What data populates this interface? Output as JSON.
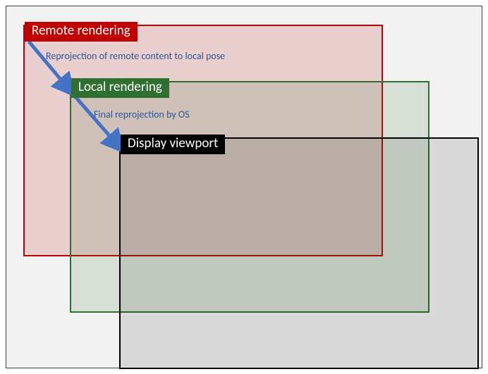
{
  "boxes": {
    "remote": {
      "label": "Remote rendering"
    },
    "local": {
      "label": "Local rendering"
    },
    "display": {
      "label": "Display viewport"
    }
  },
  "captions": {
    "reproj_remote": "Reprojection of remote content to local pose",
    "reproj_os": "Final reprojection by OS"
  },
  "arrow_color": "#4472C4"
}
